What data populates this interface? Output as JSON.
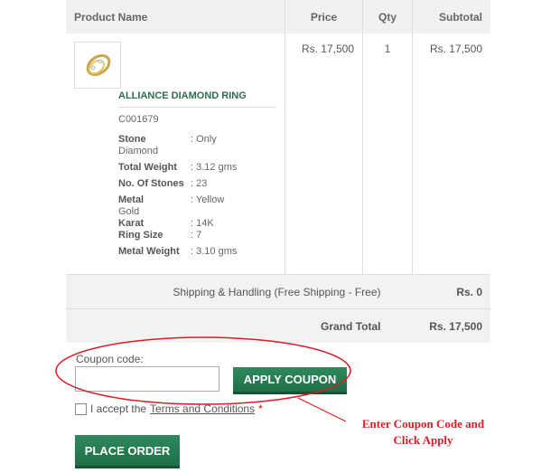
{
  "table": {
    "headers": {
      "product": "Product Name",
      "price": "Price",
      "qty": "Qty",
      "subtotal": "Subtotal"
    },
    "item": {
      "name": "ALLIANCE DIAMOND RING",
      "sku": "C001679",
      "price": "Rs. 17,500",
      "qty": "1",
      "subtotal": "Rs. 17,500",
      "thumbnail_icon": "ring-image",
      "attributes": [
        {
          "key": "Stone",
          "value": ": Only",
          "cont": "Diamond"
        },
        {
          "key": "Total Weight",
          "value": ": 3.12 gms"
        },
        {
          "key": "No. Of Stones",
          "value": ": 23"
        },
        {
          "key": "Metal",
          "value": ": Yellow",
          "cont": "Gold"
        },
        {
          "key": "Karat",
          "value": ": 14K"
        },
        {
          "key": "Ring Size",
          "value": ": 7"
        },
        {
          "key": "Metal Weight",
          "value": ": 3.10 gms"
        }
      ]
    },
    "shipping": {
      "label": "Shipping & Handling (Free Shipping - Free)",
      "value": "Rs. 0"
    },
    "grand_total": {
      "label": "Grand Total",
      "value": "Rs. 17,500"
    }
  },
  "coupon": {
    "label": "Coupon code:",
    "value": "",
    "apply_label": "APPLY COUPON"
  },
  "terms": {
    "prefix": "I accept the",
    "link": "Terms and Conditions",
    "required_mark": "*"
  },
  "place_order_label": "PLACE ORDER",
  "annotation": {
    "line1": "Enter Coupon Code and",
    "line2": "Click Apply",
    "color": "#d81d24"
  },
  "colors": {
    "button_green": "#2f8a5e",
    "product_link": "#2f6d4f"
  }
}
